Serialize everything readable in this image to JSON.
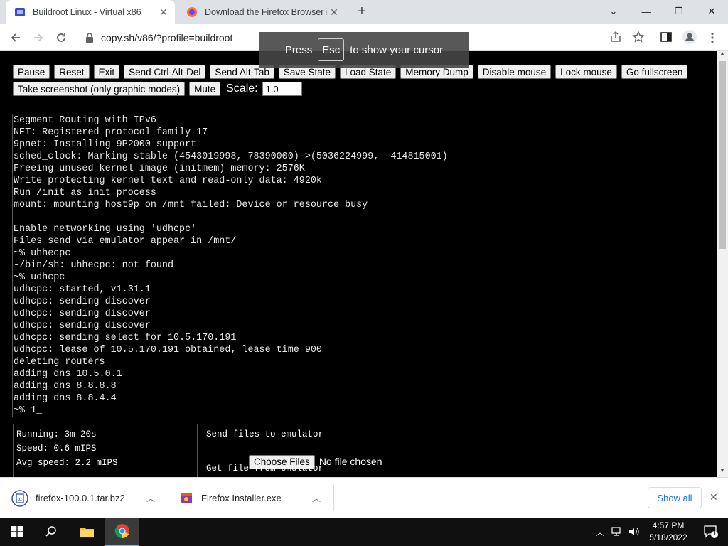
{
  "browser": {
    "tabs": [
      {
        "title": "Buildroot Linux - Virtual x86",
        "active": true
      },
      {
        "title": "Download the Firefox Browser in",
        "active": false
      }
    ],
    "url": "copy.sh/v86/?profile=buildroot"
  },
  "toast": {
    "before": "Press",
    "key": "Esc",
    "after": "to show your cursor"
  },
  "controls": {
    "row1": [
      "Pause",
      "Reset",
      "Exit",
      "Send Ctrl-Alt-Del",
      "Send Alt-Tab",
      "Save State",
      "Load State",
      "Memory Dump",
      "Disable mouse",
      "Lock mouse",
      "Go fullscreen"
    ],
    "row2": [
      "Take screenshot (only graphic modes)",
      "Mute"
    ],
    "scale_label": "Scale:",
    "scale_value": "1.0"
  },
  "terminal": {
    "lines": [
      "Segment Routing with IPv6",
      "NET: Registered protocol family 17",
      "9pnet: Installing 9P2000 support",
      "sched_clock: Marking stable (4543019998, 78390000)->(5036224999, -414815001)",
      "Freeing unused kernel image (initmem) memory: 2576K",
      "Write protecting kernel text and read-only data: 4920k",
      "Run /init as init process",
      "mount: mounting host9p on /mnt failed: Device or resource busy",
      "",
      "Enable networking using 'udhcpc'",
      "Files send via emulator appear in /mnt/",
      "~% uhhecpc",
      "-/bin/sh: uhhecpc: not found",
      "~% udhcpc",
      "udhcpc: started, v1.31.1",
      "udhcpc: sending discover",
      "udhcpc: sending discover",
      "udhcpc: sending discover",
      "udhcpc: sending select for 10.5.170.191",
      "udhcpc: lease of 10.5.170.191 obtained, lease time 900",
      "deleting routers",
      "adding dns 10.5.0.1",
      "adding dns 8.8.8.8",
      "adding dns 8.8.4.4",
      "~% 1_"
    ]
  },
  "stats": {
    "running": "Running: 3m 20s",
    "speed": "Speed: 0.6 mIPS",
    "avg_speed": "Avg speed: 2.2 mIPS"
  },
  "files": {
    "send_title": "Send files to emulator",
    "choose_label": "Choose Files",
    "no_file": "No file chosen",
    "get_title": "Get file from emulator"
  },
  "downloads": {
    "items": [
      {
        "name": "firefox-100.0.1.tar.bz2",
        "icon": "archive-file-icon"
      },
      {
        "name": "Firefox Installer.exe",
        "icon": "installer-icon"
      }
    ],
    "show_all": "Show all"
  },
  "taskbar": {
    "time": "4:57 PM",
    "date": "5/18/2022",
    "notifications": "1"
  },
  "colors": {
    "accent": "#1a73e8",
    "tab_strip": "#dee1e6",
    "content_bg": "#000000",
    "taskbar": "#101010"
  }
}
